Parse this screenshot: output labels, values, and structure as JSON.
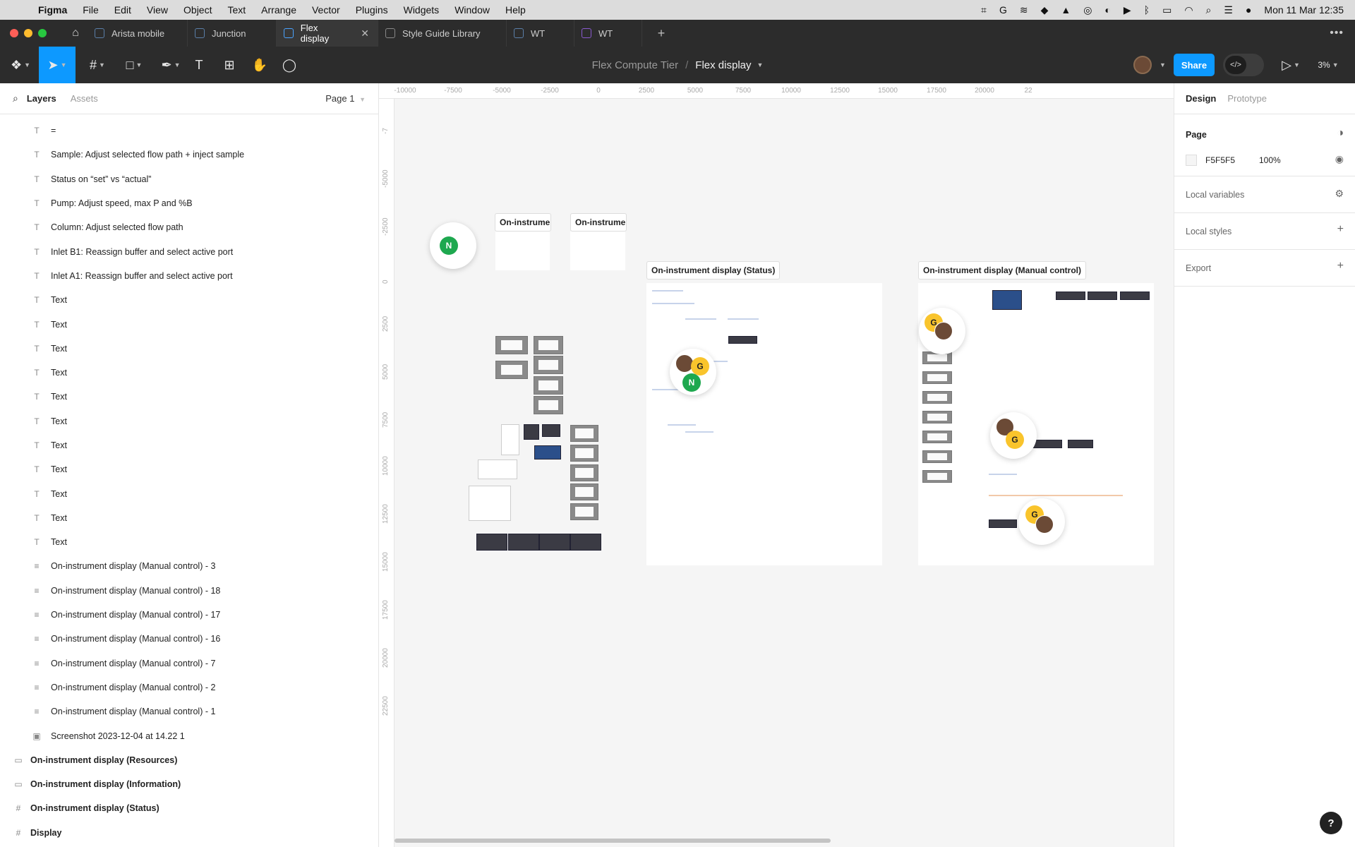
{
  "menubar": {
    "app": "Figma",
    "items": [
      "File",
      "Edit",
      "View",
      "Object",
      "Text",
      "Arrange",
      "Vector",
      "Plugins",
      "Widgets",
      "Window",
      "Help"
    ],
    "clock": "Mon 11 Mar  12:35"
  },
  "tabs": [
    {
      "label": "Arista mobile"
    },
    {
      "label": "Junction"
    },
    {
      "label": "Flex display"
    },
    {
      "label": "Style Guide Library"
    },
    {
      "label": "WT"
    },
    {
      "label": "WT"
    }
  ],
  "toolbar": {
    "project": "Flex Compute Tier",
    "file": "Flex display",
    "share_label": "Share",
    "zoom": "3%"
  },
  "left_panel": {
    "tab_layers": "Layers",
    "tab_assets": "Assets",
    "page": "Page 1",
    "layers": [
      {
        "label": "=",
        "icon": "T"
      },
      {
        "label": "Sample: Adjust selected flow path + inject sample",
        "icon": "T"
      },
      {
        "label": "Status on “set” vs “actual”",
        "icon": "T"
      },
      {
        "label": "Pump: Adjust speed, max P and %B",
        "icon": "T"
      },
      {
        "label": "Column: Adjust selected flow path",
        "icon": "T"
      },
      {
        "label": "Inlet B1: Reassign buffer and select active port",
        "icon": "T"
      },
      {
        "label": "Inlet A1: Reassign buffer and select active port",
        "icon": "T"
      },
      {
        "label": "Text",
        "icon": "T"
      },
      {
        "label": "Text",
        "icon": "T"
      },
      {
        "label": "Text",
        "icon": "T"
      },
      {
        "label": "Text",
        "icon": "T"
      },
      {
        "label": "Text",
        "icon": "T"
      },
      {
        "label": "Text",
        "icon": "T"
      },
      {
        "label": "Text",
        "icon": "T"
      },
      {
        "label": "Text",
        "icon": "T"
      },
      {
        "label": "Text",
        "icon": "T"
      },
      {
        "label": "Text",
        "icon": "T"
      },
      {
        "label": "Text",
        "icon": "T"
      },
      {
        "label": "On-instrument display (Manual control) - 3",
        "icon": "≡"
      },
      {
        "label": "On-instrument display (Manual control) - 18",
        "icon": "≡"
      },
      {
        "label": "On-instrument display (Manual control) - 17",
        "icon": "≡"
      },
      {
        "label": "On-instrument display (Manual control) - 16",
        "icon": "≡"
      },
      {
        "label": "On-instrument display (Manual control) - 7",
        "icon": "≡"
      },
      {
        "label": "On-instrument display (Manual control) - 2",
        "icon": "≡"
      },
      {
        "label": "On-instrument display (Manual control) - 1",
        "icon": "≡"
      },
      {
        "label": "Screenshot 2023-12-04 at 14.22 1",
        "icon": "▣"
      },
      {
        "label": "On-instrument display (Resources)",
        "icon": "▭",
        "top": true
      },
      {
        "label": "On-instrument display (Information)",
        "icon": "▭",
        "top": true
      },
      {
        "label": "On-instrument display (Status)",
        "icon": "#",
        "top": true
      },
      {
        "label": "Display",
        "icon": "#",
        "top": true
      }
    ]
  },
  "canvas": {
    "ruler_h": [
      "-10000",
      "-7500",
      "-5000",
      "-2500",
      "0",
      "2500",
      "5000",
      "7500",
      "10000",
      "12500",
      "15000",
      "17500",
      "20000",
      "22"
    ],
    "ruler_v": [
      "-7",
      "-5000",
      "-2500",
      "0",
      "2500",
      "5000",
      "7500",
      "10000",
      "12500",
      "15000",
      "17500",
      "20000",
      "22500"
    ],
    "frames": {
      "resources": "On-instrumen...",
      "information": "On-instrumen...",
      "status": "On-instrument display (Status)",
      "manual": "On-instrument display (Manual control)"
    },
    "collaborators": {
      "g": "G",
      "n": "N"
    }
  },
  "right_panel": {
    "tab_design": "Design",
    "tab_prototype": "Prototype",
    "page_heading": "Page",
    "page_color": "F5F5F5",
    "page_opacity": "100%",
    "local_variables": "Local variables",
    "local_styles": "Local styles",
    "export": "Export"
  },
  "colors": {
    "accent": "#0d99ff",
    "canvas": "#f5f5f5"
  }
}
